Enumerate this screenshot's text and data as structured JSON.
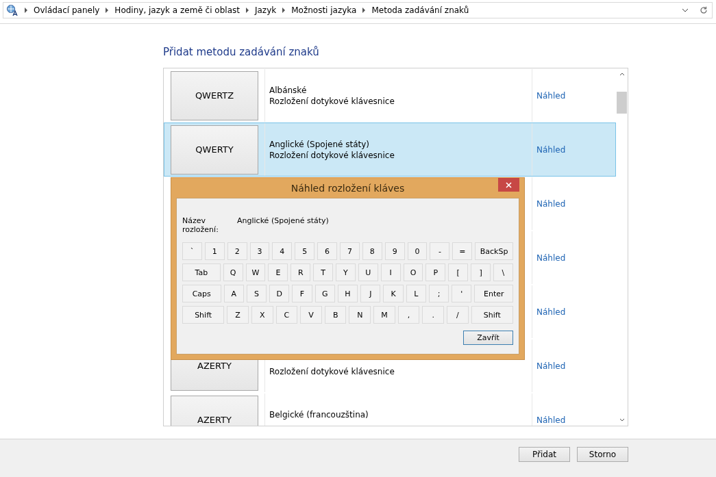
{
  "breadcrumb": [
    "Ovládací panely",
    "Hodiny, jazyk a země či oblast",
    "Jazyk",
    "Možnosti jazyka",
    "Metoda zadávání znaků"
  ],
  "heading": "Přidat metodu zadávání znaků",
  "methods": [
    {
      "layout": "QWERTZ",
      "name": "Albánské",
      "description": "Rozložení dotykové klávesnice",
      "link": "Náhled",
      "selected": false
    },
    {
      "layout": "QWERTY",
      "name": "Anglické (Spojené státy)",
      "description": "Rozložení dotykové klávesnice",
      "link": "Náhled",
      "selected": true
    },
    {
      "link": "Náhled",
      "selected": false
    },
    {
      "link": "Náhled",
      "selected": false
    },
    {
      "link": "Náhled",
      "selected": false
    },
    {
      "layout": "AZERTY",
      "description": "Rozložení dotykové klávesnice",
      "link": "Náhled",
      "selected": false
    },
    {
      "layout": "AZERTY",
      "name": "Belgické (francouzština)",
      "link": "Náhled",
      "selected": false
    }
  ],
  "dialog": {
    "title": "Náhled rozložení kláves",
    "name_label": "Název rozložení:",
    "name_value": "Anglické (Spojené státy)",
    "keys": [
      [
        {
          "label": "`",
          "kind": "key"
        },
        {
          "label": "1",
          "kind": "key"
        },
        {
          "label": "2",
          "kind": "key"
        },
        {
          "label": "3",
          "kind": "key"
        },
        {
          "label": "4",
          "kind": "key"
        },
        {
          "label": "5",
          "kind": "key"
        },
        {
          "label": "6",
          "kind": "key"
        },
        {
          "label": "7",
          "kind": "key"
        },
        {
          "label": "8",
          "kind": "key"
        },
        {
          "label": "9",
          "kind": "key"
        },
        {
          "label": "0",
          "kind": "key"
        },
        {
          "label": "-",
          "kind": "key"
        },
        {
          "label": "=",
          "kind": "key"
        },
        {
          "label": "BackSp",
          "kind": "wide"
        }
      ],
      [
        {
          "label": "Tab",
          "kind": "wide"
        },
        {
          "label": "Q",
          "kind": "key"
        },
        {
          "label": "W",
          "kind": "key"
        },
        {
          "label": "E",
          "kind": "key"
        },
        {
          "label": "R",
          "kind": "key"
        },
        {
          "label": "T",
          "kind": "key"
        },
        {
          "label": "Y",
          "kind": "key"
        },
        {
          "label": "U",
          "kind": "key"
        },
        {
          "label": "I",
          "kind": "key"
        },
        {
          "label": "O",
          "kind": "key"
        },
        {
          "label": "P",
          "kind": "key"
        },
        {
          "label": "[",
          "kind": "key"
        },
        {
          "label": "]",
          "kind": "key"
        },
        {
          "label": "\\",
          "kind": "key"
        }
      ],
      [
        {
          "label": "Caps",
          "kind": "wide"
        },
        {
          "label": "A",
          "kind": "key"
        },
        {
          "label": "S",
          "kind": "key"
        },
        {
          "label": "D",
          "kind": "key"
        },
        {
          "label": "F",
          "kind": "key"
        },
        {
          "label": "G",
          "kind": "key"
        },
        {
          "label": "H",
          "kind": "key"
        },
        {
          "label": "J",
          "kind": "key"
        },
        {
          "label": "K",
          "kind": "key"
        },
        {
          "label": "L",
          "kind": "key"
        },
        {
          "label": ";",
          "kind": "key"
        },
        {
          "label": "'",
          "kind": "key"
        },
        {
          "label": "Enter",
          "kind": "wide"
        }
      ],
      [
        {
          "label": "Shift",
          "kind": "wide"
        },
        {
          "label": "Z",
          "kind": "key"
        },
        {
          "label": "X",
          "kind": "key"
        },
        {
          "label": "C",
          "kind": "key"
        },
        {
          "label": "V",
          "kind": "key"
        },
        {
          "label": "B",
          "kind": "key"
        },
        {
          "label": "N",
          "kind": "key"
        },
        {
          "label": "M",
          "kind": "key"
        },
        {
          "label": ",",
          "kind": "key"
        },
        {
          "label": ".",
          "kind": "key"
        },
        {
          "label": "/",
          "kind": "key"
        },
        {
          "label": "Shift",
          "kind": "wide"
        }
      ]
    ],
    "close_button": "Zavřít"
  },
  "buttons": [
    "Přidat",
    "Storno"
  ]
}
